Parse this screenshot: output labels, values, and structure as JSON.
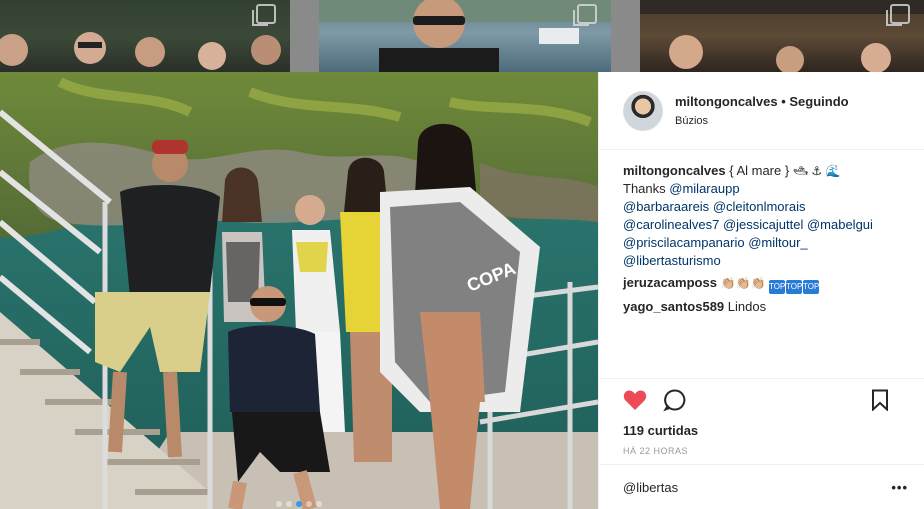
{
  "post": {
    "username": "miltongoncalves",
    "separator": "•",
    "follow_status": "Seguindo",
    "location": "Búzios"
  },
  "comments": [
    {
      "user": "miltongoncalves",
      "title": "{ Al mare }",
      "emoji": "🛥 ⚓ 🌊",
      "text": "Thanks",
      "tags": [
        "@milaraupp",
        "@barbaraareis",
        "@cleitonlmorais",
        "@carolinealves7",
        "@jessicajuttel",
        "@mabelgui",
        "@priscilacampanario",
        "@miltour_",
        "@libertasturismo"
      ]
    },
    {
      "user": "jeruzacamposs",
      "emoji": "👏🏼👏🏼👏🏼",
      "badges": [
        "TOP",
        "TOP",
        "TOP"
      ]
    },
    {
      "user": "yago_santos589",
      "text": "Lindos"
    }
  ],
  "likes": "119 curtidas",
  "time": "HÁ 22 HORAS",
  "comment_input": "@libertas",
  "more_label": "•••",
  "carousel": {
    "count": 5,
    "active_index": 2
  },
  "colors": {
    "link": "#003569",
    "like": "#ed4956",
    "dot_active": "#3897f0"
  }
}
